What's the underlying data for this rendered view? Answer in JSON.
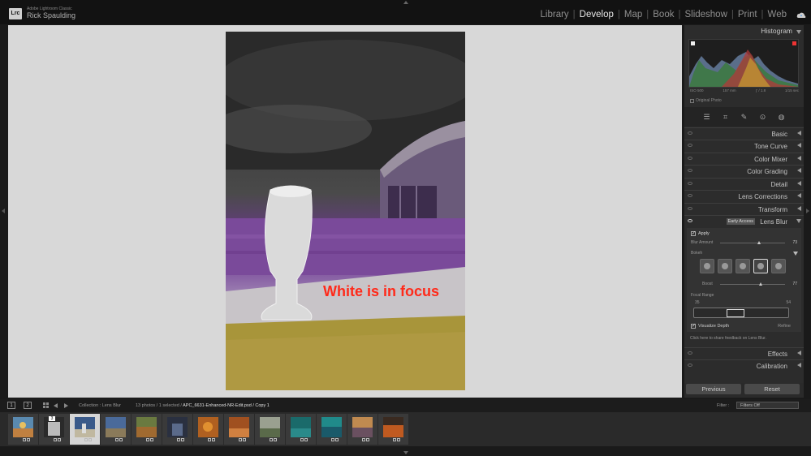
{
  "app": {
    "logo": "Lrc",
    "product_name": "Adobe Lightroom Classic",
    "user": "Rick Spaulding"
  },
  "modules": [
    "Library",
    "Develop",
    "Map",
    "Book",
    "Slideshow",
    "Print",
    "Web"
  ],
  "active_module": "Develop",
  "canvas": {
    "overlay_text": "White is in focus"
  },
  "histogram": {
    "title": "Histogram",
    "iso": "ISO 500",
    "focal": "157 mm",
    "aperture": "ƒ / 1.8",
    "shutter": "1/15 sec",
    "original_photo": "Original Photo"
  },
  "panels": {
    "basic": "Basic",
    "tone_curve": "Tone Curve",
    "color_mixer": "Color Mixer",
    "color_grading": "Color Grading",
    "detail": "Detail",
    "lens_corrections": "Lens Corrections",
    "transform": "Transform",
    "lens_blur": "Lens Blur",
    "early_access": "Early Access",
    "effects": "Effects",
    "calibration": "Calibration"
  },
  "lens_blur": {
    "apply": "Apply",
    "blur_amount_label": "Blur Amount",
    "blur_amount": 73,
    "bokeh_label": "Bokeh",
    "boost_label": "Boost",
    "boost": 77,
    "focal_range_label": "Focal Range",
    "focal_min": "35",
    "focal_max": "54",
    "visualize_depth": "Visualize Depth",
    "refine": "Refine",
    "feedback": "Click here to share feedback on Lens Blur."
  },
  "buttons": {
    "previous": "Previous",
    "reset": "Reset"
  },
  "filmbar": {
    "screen1": "1",
    "screen2": "2",
    "collection": "Collection : Lens Blur",
    "counts": "13 photos / 1 selected /",
    "filename": "APC_6631-Enhanced-NR-Edit.psd / Copy 1",
    "filter_label": "Filter :",
    "filter_value": "Filters Off"
  },
  "filmstrip": {
    "stack_badge": "3",
    "selected_index": 2
  },
  "colors": {
    "accent_text": "#ff2a1a",
    "depth_purple": "#7a4a9a",
    "depth_yellow": "#a8953a"
  }
}
